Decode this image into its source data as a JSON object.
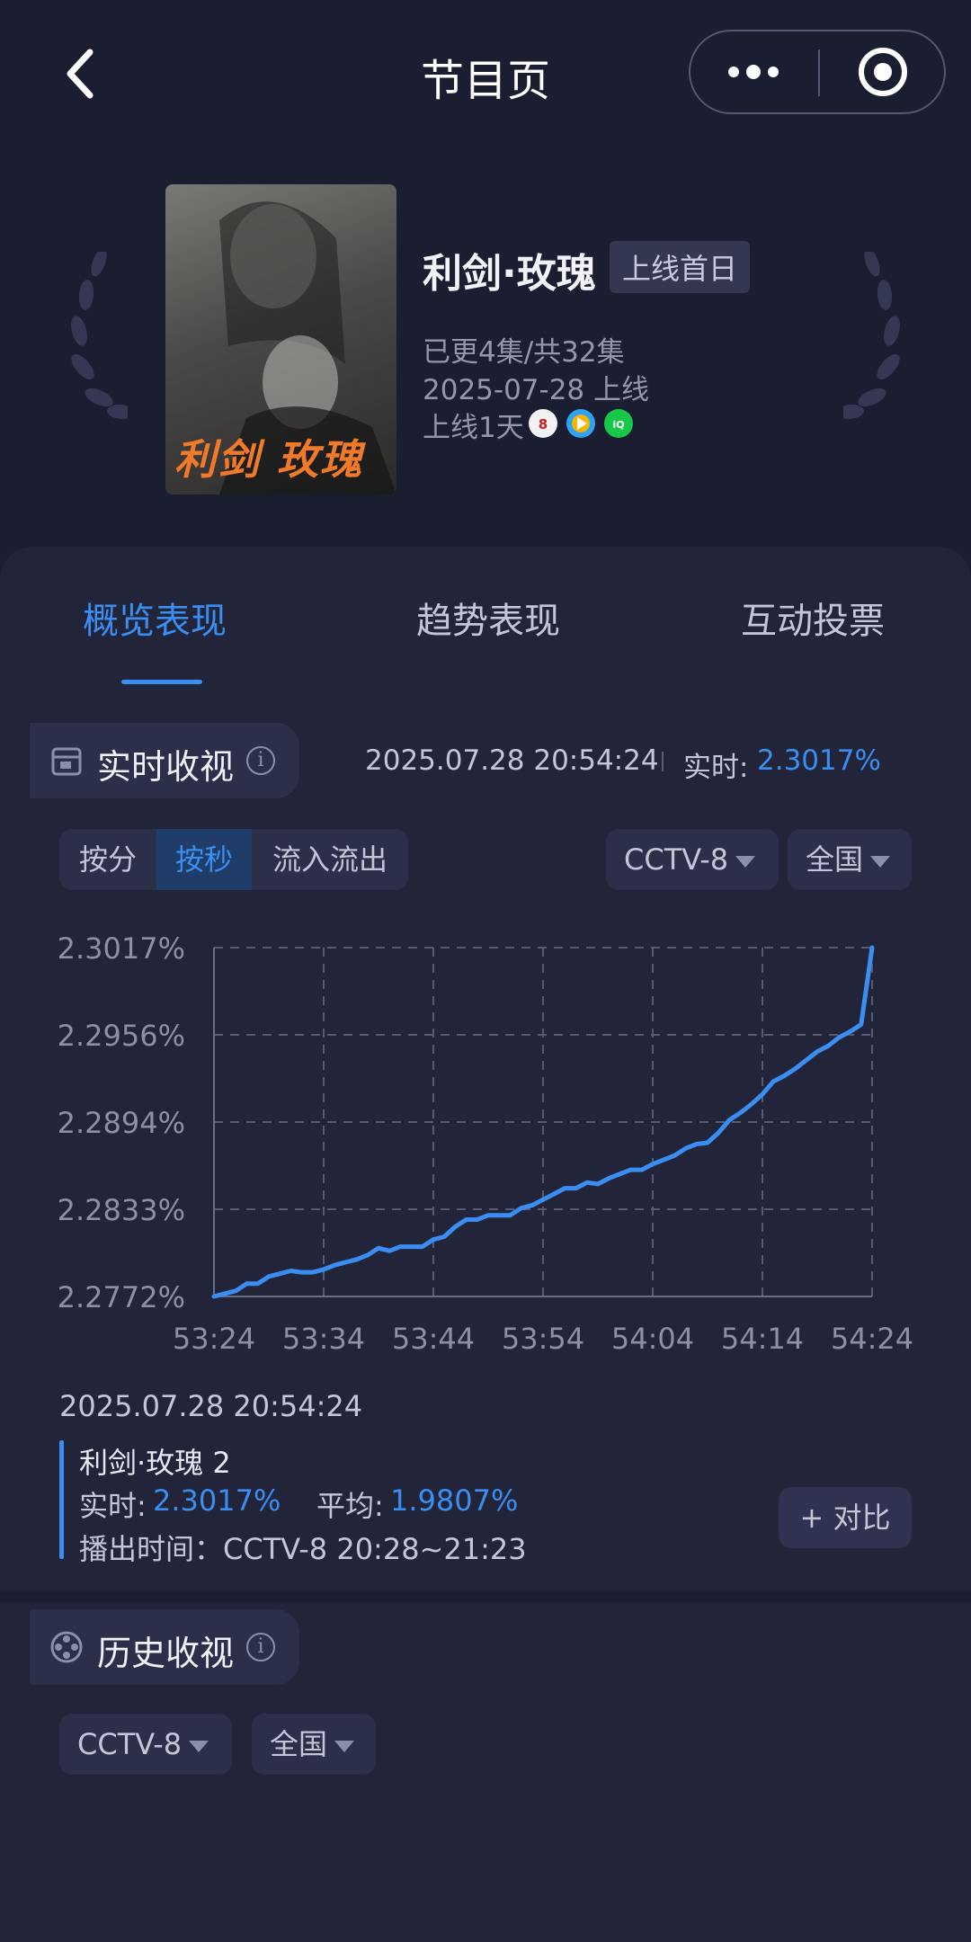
{
  "nav": {
    "title": "节目页",
    "back_icon": "chevron-left-icon",
    "more_icon": "more-dots-icon",
    "close_icon": "target-close-icon"
  },
  "show": {
    "title": "利剑·玫瑰",
    "badge": "上线首日",
    "episodes": "已更4集/共32集",
    "release": "2025-07-28 上线",
    "online_days": "上线1天",
    "poster_text": "利剑 玫瑰",
    "platforms": [
      "cctv8-logo",
      "tencent-video-logo",
      "iqiyi-logo"
    ]
  },
  "tabs": [
    {
      "label": "概览表现",
      "active": true
    },
    {
      "label": "趋势表现",
      "active": false
    },
    {
      "label": "互动投票",
      "active": false
    }
  ],
  "realtime": {
    "title": "实时收视",
    "timestamp": "2025.07.28 20:54:24",
    "rt_label": "实时:",
    "rt_value": "2.3017%",
    "segments": [
      "按分",
      "按秒",
      "流入流出"
    ],
    "active_segment": "按秒",
    "channel": "CCTV-8",
    "region": "全国",
    "detail": {
      "time": "2025.07.28 20:54:24",
      "series_name": "利剑·玫瑰 2",
      "rt_label": "实时:",
      "rt_value": "2.3017%",
      "avg_label": "平均:",
      "avg_value": "1.9807%",
      "airtime": "播出时间：CCTV-8 20:28~21:23"
    },
    "compare_label": "+ 对比"
  },
  "history": {
    "title": "历史收视",
    "channel": "CCTV-8",
    "region": "全国"
  },
  "colors": {
    "accent": "#3a8ef2",
    "background": "#1b1d30",
    "card": "#222439"
  },
  "chart_data": {
    "type": "line",
    "x_labels": [
      "53:24",
      "53:34",
      "53:44",
      "53:54",
      "54:04",
      "54:14",
      "54:24"
    ],
    "y_labels": [
      "2.3017%",
      "2.2956%",
      "2.2894%",
      "2.2833%",
      "2.2772%"
    ],
    "ylim": [
      2.2772,
      2.3017
    ],
    "grid": true,
    "series": [
      {
        "name": "利剑·玫瑰 2",
        "x": [
          0,
          2,
          3,
          4,
          5,
          6,
          7,
          8,
          9,
          10,
          11,
          12,
          13,
          14,
          15,
          16,
          17,
          18,
          19,
          20,
          21,
          22,
          23,
          24,
          25,
          26,
          27,
          28,
          29,
          30,
          31,
          32,
          33,
          34,
          35,
          36,
          37,
          38,
          39,
          40,
          41,
          42,
          43,
          44,
          45,
          46,
          47,
          48,
          49,
          50,
          51,
          52,
          53,
          54,
          55,
          56,
          57,
          58,
          59,
          60
        ],
        "values": [
          2.2772,
          2.2776,
          2.2781,
          2.2781,
          2.2786,
          2.2788,
          2.279,
          2.2789,
          2.2789,
          2.2791,
          2.2794,
          2.2796,
          2.2798,
          2.2801,
          2.2806,
          2.2804,
          2.2807,
          2.2807,
          2.2807,
          2.2812,
          2.2814,
          2.2821,
          2.2826,
          2.2826,
          2.2829,
          2.2829,
          2.2829,
          2.2834,
          2.2836,
          2.284,
          2.2844,
          2.2848,
          2.2848,
          2.2852,
          2.2851,
          2.2855,
          2.2858,
          2.2861,
          2.2861,
          2.2865,
          2.2868,
          2.2871,
          2.2876,
          2.2879,
          2.288,
          2.2887,
          2.2896,
          2.2901,
          2.2907,
          2.2914,
          2.2923,
          2.2927,
          2.2932,
          2.2938,
          2.2944,
          2.2948,
          2.2954,
          2.2958,
          2.2963,
          2.3017
        ]
      }
    ]
  }
}
